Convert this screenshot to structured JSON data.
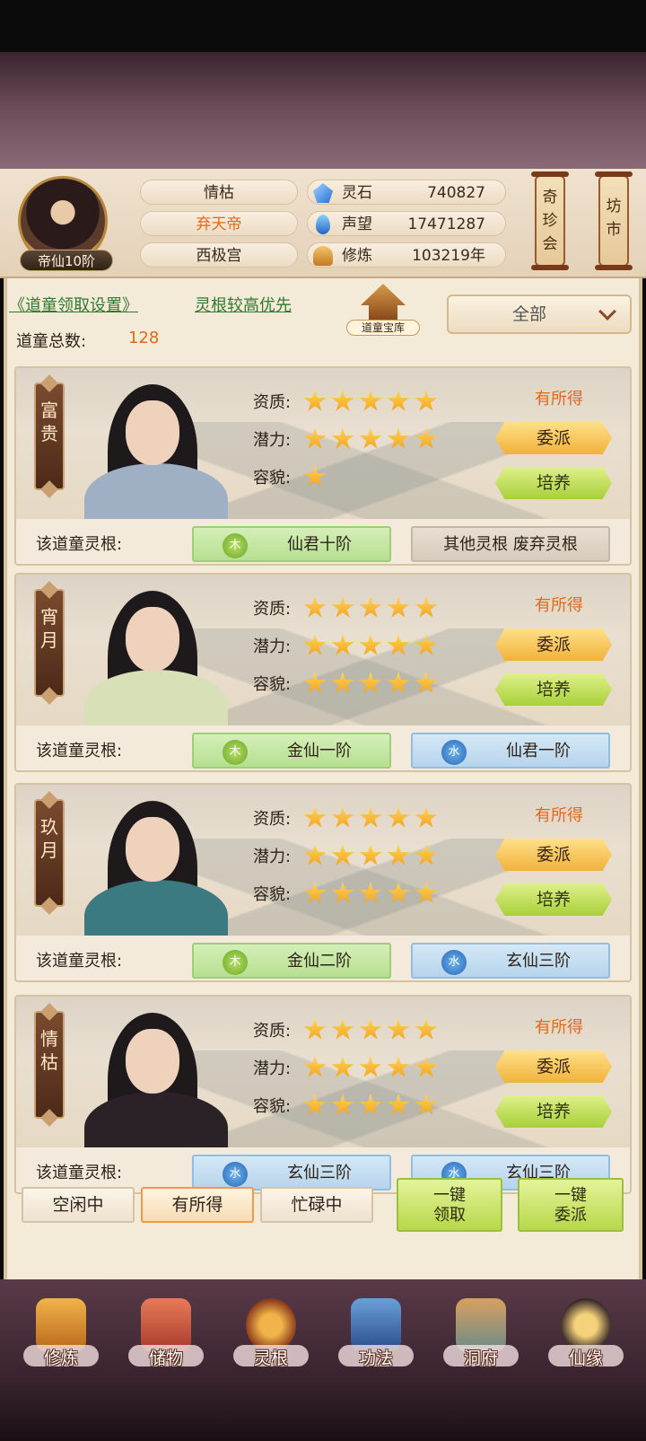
{
  "player": {
    "rank": "帝仙10阶",
    "name": "情枯",
    "title": "弃天帝",
    "palace": "西极宫"
  },
  "stats": [
    {
      "label": "灵石",
      "value": "740827",
      "icon": "spirit-stone-icon"
    },
    {
      "label": "声望",
      "value": "17471287",
      "icon": "reputation-drop-icon"
    },
    {
      "label": "修炼",
      "value": "103219年",
      "icon": "cultivation-lotus-icon"
    }
  ],
  "side_buttons": {
    "treasure": "奇珍会",
    "market": "坊市"
  },
  "toolbar": {
    "settings_link": "《道童领取设置》",
    "priority_link": "灵根较高优先",
    "treasury_label": "道童宝库",
    "filter_value": "全部",
    "total_label": "道童总数:",
    "total_value": "128"
  },
  "attr_labels": {
    "aptitude": "资质:",
    "potential": "潜力:",
    "looks": "容貌:",
    "root_label": "该道童灵根:"
  },
  "cards": [
    {
      "name": "富贵",
      "aptitude": 5,
      "potential": 5,
      "looks": 1,
      "reward": "有所得",
      "assign": "委派",
      "train": "培养",
      "roots": [
        {
          "element": "木",
          "type": "wood",
          "text": "仙君十阶"
        },
        {
          "element": "",
          "type": "gray",
          "text": "其他灵根 废弃灵根"
        }
      ]
    },
    {
      "name": "宵月",
      "aptitude": 5,
      "potential": 5,
      "looks": 5,
      "reward": "有所得",
      "assign": "委派",
      "train": "培养",
      "roots": [
        {
          "element": "木",
          "type": "wood",
          "text": "金仙一阶"
        },
        {
          "element": "水",
          "type": "water",
          "text": "仙君一阶"
        }
      ]
    },
    {
      "name": "玖月",
      "aptitude": 5,
      "potential": 5,
      "looks": 5,
      "reward": "有所得",
      "assign": "委派",
      "train": "培养",
      "roots": [
        {
          "element": "木",
          "type": "wood",
          "text": "金仙二阶"
        },
        {
          "element": "水",
          "type": "water",
          "text": "玄仙三阶"
        }
      ]
    },
    {
      "name": "情枯",
      "aptitude": 5,
      "potential": 5,
      "looks": 5,
      "reward": "有所得",
      "assign": "委派",
      "train": "培养",
      "roots": [
        {
          "element": "水",
          "type": "water",
          "text": "玄仙三阶"
        },
        {
          "element": "水",
          "type": "water",
          "text": "玄仙三阶"
        }
      ]
    }
  ],
  "filters": [
    "空闲中",
    "有所得",
    "忙碌中"
  ],
  "active_filter": "有所得",
  "actions": {
    "claim_all": "一键\n领取",
    "assign_all": "一键\n委派"
  },
  "nav": [
    {
      "label": "修炼",
      "icon": "cultivation-monk-icon"
    },
    {
      "label": "储物",
      "icon": "storage-bag-icon"
    },
    {
      "label": "灵根",
      "icon": "spirit-root-icon"
    },
    {
      "label": "功法",
      "icon": "scripture-book-icon"
    },
    {
      "label": "洞府",
      "icon": "cave-dwelling-icon"
    },
    {
      "label": "仙缘",
      "icon": "immortal-fate-icon"
    }
  ],
  "colors": {
    "accent_orange": "#e0691a",
    "link_green": "#2f7a2f",
    "star": "#f2a018"
  }
}
